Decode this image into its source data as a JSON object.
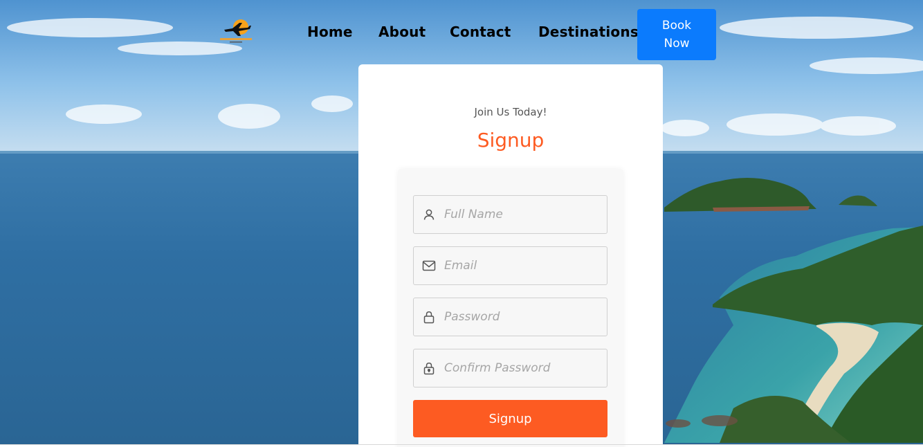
{
  "nav": {
    "logo_icon": "airplane-sun-logo-icon",
    "links": [
      {
        "label": "Home"
      },
      {
        "label": "About"
      },
      {
        "label": "Contact"
      },
      {
        "label": "Destinations"
      }
    ],
    "book_button": "Book Now"
  },
  "signup": {
    "subtitle": "Join Us Today!",
    "title": "Signup",
    "fields": [
      {
        "icon": "user-icon",
        "placeholder": "Full Name",
        "value": ""
      },
      {
        "icon": "envelope-icon",
        "placeholder": "Email",
        "value": ""
      },
      {
        "icon": "lock-icon",
        "placeholder": "Password",
        "value": ""
      },
      {
        "icon": "lock-keyhole-icon",
        "placeholder": "Confirm Password",
        "value": ""
      }
    ],
    "submit_label": "Signup"
  },
  "colors": {
    "accent": "#fd5b22",
    "nav_button": "#0b7bfd",
    "logo_sun": "#f7a21b"
  }
}
